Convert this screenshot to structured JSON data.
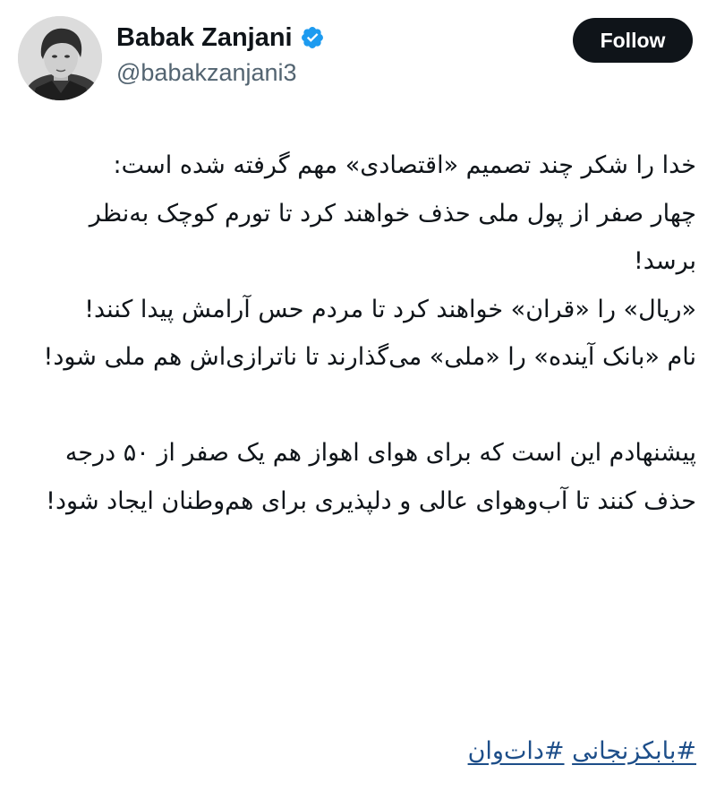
{
  "header": {
    "avatar_icon": "profile-photo",
    "display_name": "Babak Zanjani",
    "verified_icon": "verified-badge-icon",
    "handle": "@babakzanjani3",
    "follow_label": "Follow"
  },
  "tweet": {
    "body": "خدا را شکر چند تصمیم «اقتصادی» مهم گرفته شده است:\nچهار صفر از پول ملی حذف خواهند کرد  تا تورم کوچک به‌نظر برسد!\n«ریال» را «قران» خواهند کرد تا مردم حس آرامش پیدا کنند!\nنام «بانک آینده» را «ملی» می‌گذارند تا ناترازی‌اش هم ملی شود!\n\nپیشنهادم این است که برای هوای اهواز هم یک صفر از ۵۰ درجه حذف کنند تا آب‌وهوای عالی و دلپذیری برای هم‌وطنان ایجاد شود!",
    "hashtags": [
      "#بابکزنجانی",
      "#دات‌وان"
    ]
  },
  "colors": {
    "follow_bg": "#0f1419",
    "verified": "#1d9bf0",
    "handle": "#536471",
    "hashtag": "#1d4e89"
  }
}
